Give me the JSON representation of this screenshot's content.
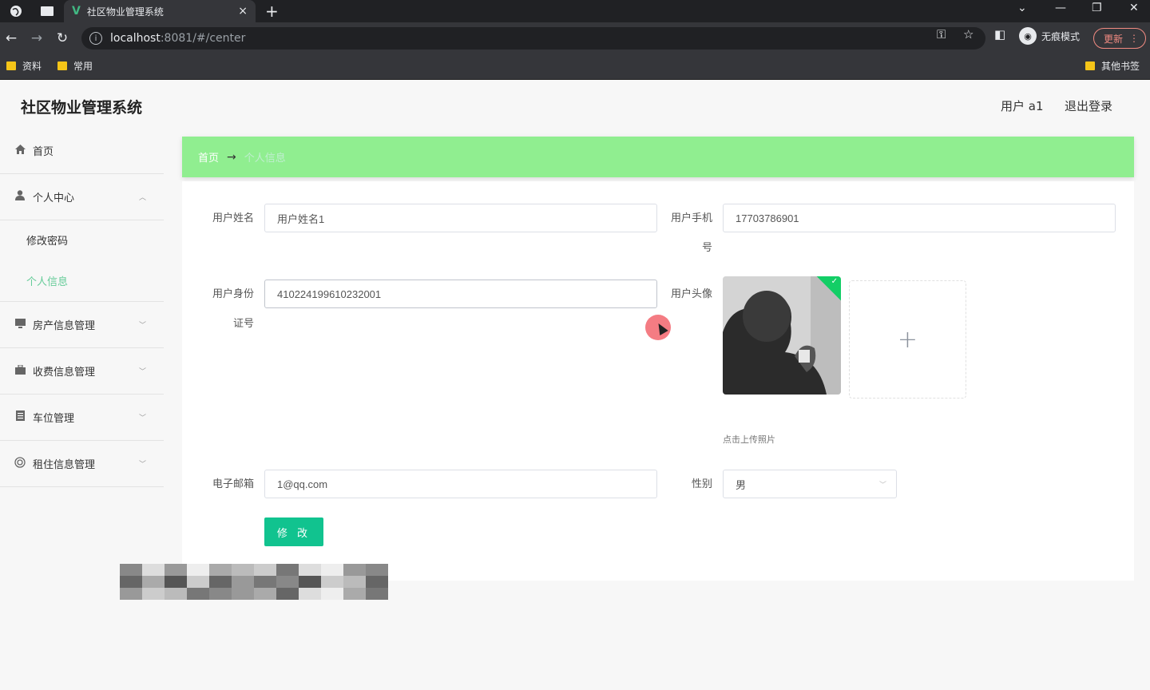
{
  "browser": {
    "tab_title": "社区物业管理系统",
    "tab_close": "×",
    "new_tab": "+",
    "url_host": "localhost",
    "url_path": ":8081/#/center",
    "incognito_label": "无痕模式",
    "update_label": "更新",
    "bookmarks": [
      "资料",
      "常用"
    ],
    "other_bookmarks": "其他书签"
  },
  "app": {
    "title": "社区物业管理系统",
    "user_label": "用户 a1",
    "logout_label": "退出登录"
  },
  "sidebar": {
    "items": [
      {
        "label": "首页",
        "icon": "home-icon"
      },
      {
        "label": "个人中心",
        "icon": "user-icon"
      },
      {
        "label": "房产信息管理",
        "icon": "monitor-icon"
      },
      {
        "label": "收费信息管理",
        "icon": "briefcase-icon"
      },
      {
        "label": "车位管理",
        "icon": "document-icon"
      },
      {
        "label": "租住信息管理",
        "icon": "circle-icon"
      }
    ],
    "submenu": [
      "修改密码",
      "个人信息"
    ]
  },
  "breadcrumb": {
    "home": "首页",
    "arrow": "→",
    "current": "个人信息"
  },
  "form": {
    "name_label": "用户姓名",
    "name_value": "用户姓名1",
    "phone_label_line1": "用户手机",
    "phone_label_line2": "号",
    "phone_value": "17703786901",
    "idcard_label_line1": "用户身份",
    "idcard_label_line2": "证号",
    "idcard_value": "410224199610232001",
    "avatar_label": "用户头像",
    "upload_plus": "+",
    "upload_hint": "点击上传照片",
    "email_label": "电子邮箱",
    "email_value": "1@qq.com",
    "gender_label": "性别",
    "gender_value": "男",
    "submit_label": "修 改"
  },
  "colors": {
    "breadcrumb_bg": "#90ee90",
    "accent": "#11c38f",
    "active_menu": "#66cc99"
  }
}
